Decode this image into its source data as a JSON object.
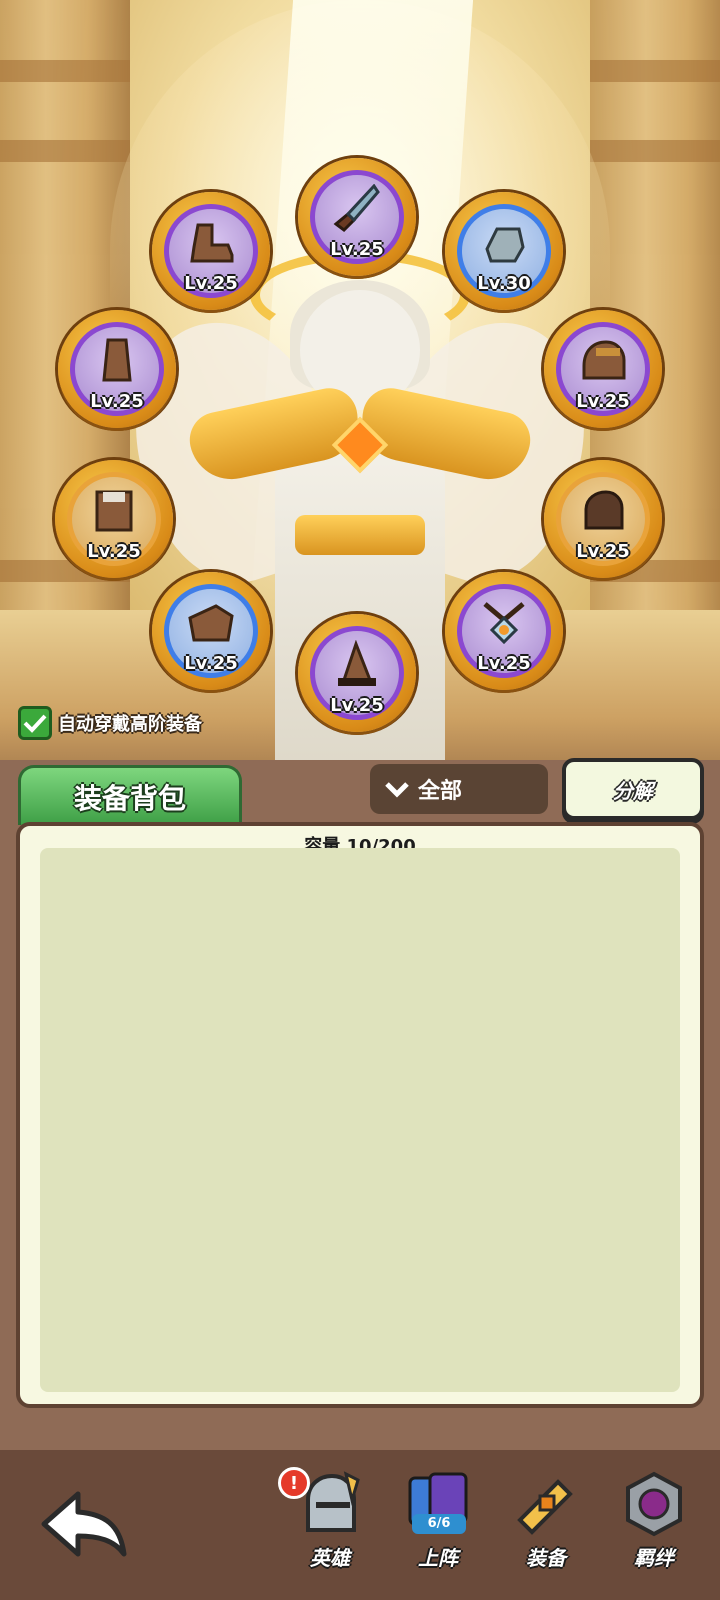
{
  "equipment_slots": [
    {
      "id": "boots",
      "level": "Lv.25",
      "rarity": "purple",
      "icon": "boots-icon"
    },
    {
      "id": "dagger",
      "level": "Lv.25",
      "rarity": "purple",
      "icon": "dagger-icon"
    },
    {
      "id": "bracer",
      "level": "Lv.30",
      "rarity": "blue",
      "icon": "bracer-icon"
    },
    {
      "id": "gauntlet",
      "level": "Lv.25",
      "rarity": "purple",
      "icon": "gauntlet-icon"
    },
    {
      "id": "helmet",
      "level": "Lv.25",
      "rarity": "purple",
      "icon": "helmet-icon"
    },
    {
      "id": "chestplate",
      "level": "Lv.25",
      "rarity": "blue",
      "icon": "chestplate-icon"
    },
    {
      "id": "glove",
      "level": "Lv.25",
      "rarity": "blue",
      "icon": "glove-icon"
    },
    {
      "id": "greaves",
      "level": "Lv.25",
      "rarity": "blue",
      "icon": "greaves-icon"
    },
    {
      "id": "amulet",
      "level": "Lv.25",
      "rarity": "purple",
      "icon": "amulet-icon"
    },
    {
      "id": "hat",
      "level": "Lv.25",
      "rarity": "purple",
      "icon": "hat-icon"
    }
  ],
  "auto_equip": {
    "label": "自动穿戴高阶装备",
    "checked": true
  },
  "inventory": {
    "tab_label": "装备背包",
    "filter_label": "全部",
    "decompose_label": "分解",
    "capacity_text": "容量 10/200"
  },
  "nav": {
    "back_icon": "back-arrow-icon",
    "badge": "!",
    "items": [
      {
        "label": "英雄",
        "icon": "knight-helmet-icon",
        "active": false
      },
      {
        "label": "上阵",
        "icon": "cards-icon",
        "active": false,
        "count": "6/6"
      },
      {
        "label": "装备",
        "icon": "equipment-icon",
        "active": true
      },
      {
        "label": "羁绊",
        "icon": "bond-icon",
        "active": false
      }
    ]
  },
  "colors": {
    "purple_rarity": "#8b48d0",
    "blue_rarity": "#3f7ee8",
    "tab_green": "#3e9f46",
    "panel_brown": "#8f6b56"
  }
}
